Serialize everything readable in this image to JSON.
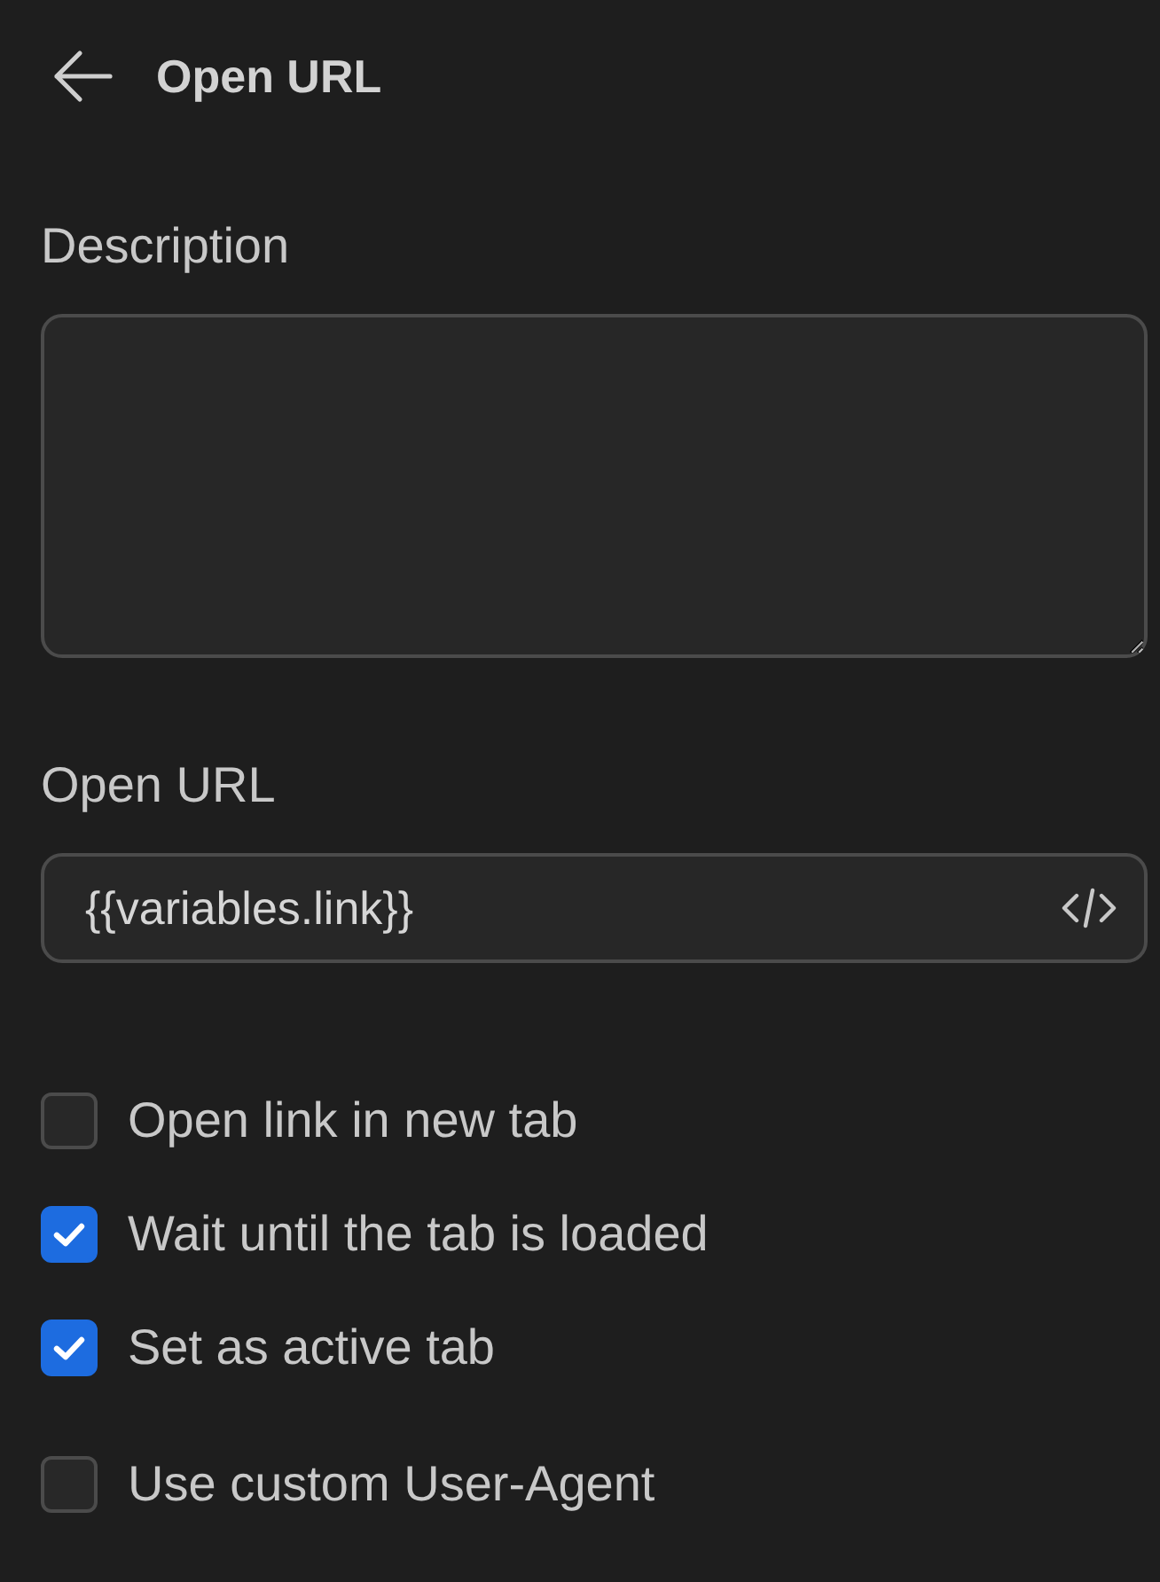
{
  "header": {
    "title": "Open URL"
  },
  "description": {
    "label": "Description"
  },
  "url": {
    "label": "Open URL",
    "value": "{{variables.link}}"
  },
  "options": [
    {
      "label": "Open link in new tab",
      "checked": false
    },
    {
      "label": "Wait until the tab is loaded",
      "checked": true
    },
    {
      "label": "Set as active tab",
      "checked": true
    }
  ],
  "user_agent": {
    "label": "Use custom User-Agent",
    "checked": false
  }
}
